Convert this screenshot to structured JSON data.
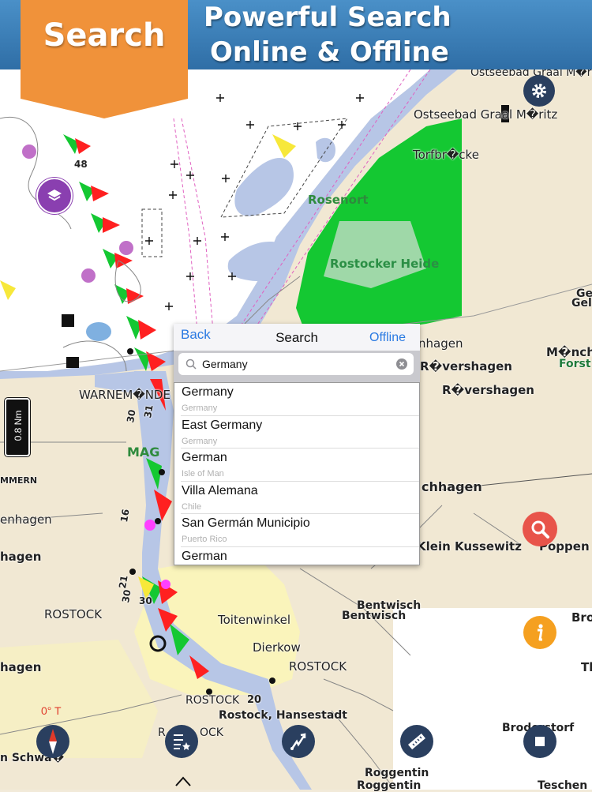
{
  "banner": {
    "headline_line1": "Powerful Search",
    "headline_line2": "Online & Offline",
    "ribbon_label": "Search"
  },
  "map_labels": {
    "ostseebad_top": "Ostseebad Graal M�ritz",
    "ostseebad": "Ostseebad Graal M�ritz",
    "torfbrucke": "Torfbr�cke",
    "rosenort": "Rosenort",
    "rostocker_heide": "Rostocker Heide",
    "gel": "Ge",
    "gel2": "Gel",
    "munch": "M�nch",
    "forst": "Forst",
    "rovershagen1": "R�vershagen",
    "rovershagen2": "R�vershagen",
    "nhagen_behind": "nhagen",
    "warnemunde": "WARNEM�NDE",
    "mag": "MAG",
    "mmern": "MMERN",
    "enhagen": "enhagen",
    "hagen1": "hagen",
    "chhagen": "chhagen",
    "klein_kussewitz": "Klein Kussewitz",
    "poppen": "Poppen",
    "bentwisch1": "Bentwisch",
    "bentwisch2": "Bentwisch",
    "rostock1": "ROSTOCK",
    "toitenwinkel": "Toitenwinkel",
    "dierkow": "Dierkow",
    "rostock2": "ROSTOCK",
    "rostock3": "ROSTOCK",
    "rostock_hansestadt": "Rostock, Hansestadt",
    "hagen2": "hagen",
    "n_schwa": "n Schwa�",
    "rock": "R",
    "ock": "OCK",
    "brodersdorf": "Broderstorf",
    "roggentin1": "Roggentin",
    "roggentin2": "Roggentin",
    "teschen": "Teschen",
    "bro": "Bro",
    "th": "Th",
    "depth48": "48",
    "depth30a": "30",
    "depth30b": "30",
    "depth20": "20",
    "ch31": "31",
    "ch30": "30",
    "ch16": "16",
    "ch21": "21"
  },
  "scale_bar": {
    "label": "0.8 Nm"
  },
  "compass": {
    "label": "0° T"
  },
  "search_panel": {
    "back_label": "Back",
    "title": "Search",
    "offline_label": "Offline",
    "query": "Germany",
    "results": [
      {
        "name": "Germany",
        "country": "Germany"
      },
      {
        "name": "East Germany",
        "country": "Germany"
      },
      {
        "name": "German",
        "country": "Isle of Man"
      },
      {
        "name": "Villa Alemana",
        "country": "Chile"
      },
      {
        "name": "San Germán Municipio",
        "country": "Puerto Rico"
      },
      {
        "name": "German",
        "country": ""
      }
    ]
  },
  "icons": {
    "settings": "gear-icon",
    "layers": "layers-icon",
    "search": "magnifier-icon",
    "info": "info-icon",
    "compass": "compass-icon",
    "route_list": "route-list-icon",
    "route": "route-icon",
    "measure": "ruler-icon",
    "record": "stop-icon"
  },
  "colors": {
    "banner_blue": "#3a7fbb",
    "ribbon_orange": "#f0923a",
    "land_green": "#14c832",
    "water_blue": "#b7c6e6",
    "link_blue": "#2a7ae2",
    "tool_dark": "#2a3f5f"
  }
}
